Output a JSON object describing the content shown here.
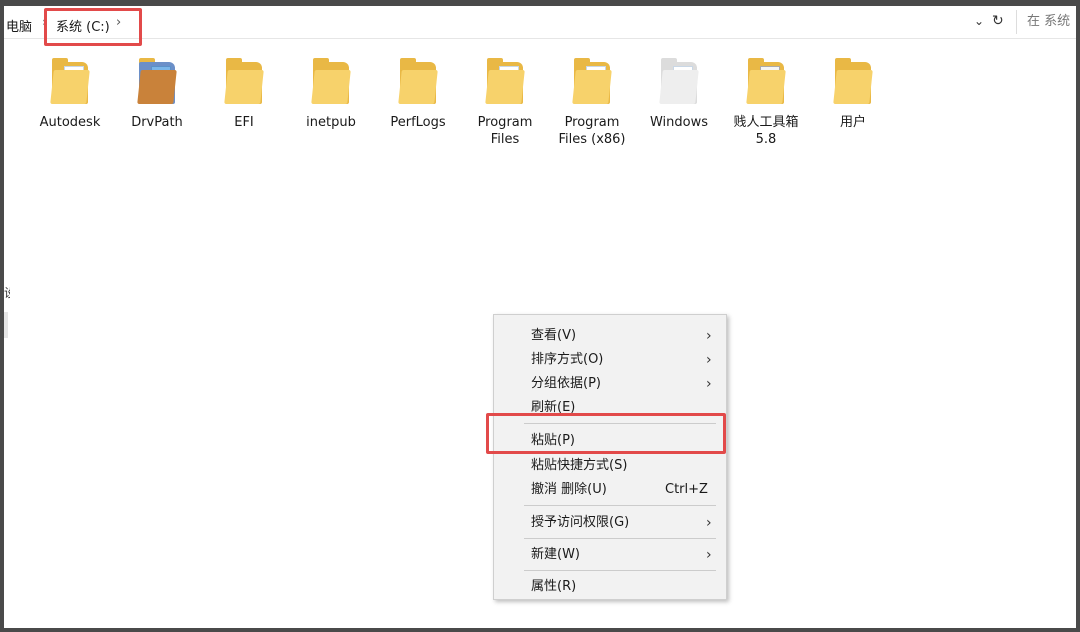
{
  "address_bar": {
    "prev_crumb": "电脑",
    "current_crumb": "系统 (C:)",
    "search_placeholder": "在 系统"
  },
  "folders": [
    {
      "name": "Autodesk",
      "icon": "folder-icon"
    },
    {
      "name": "DrvPath",
      "icon": "winrar-folder-icon"
    },
    {
      "name": "EFI",
      "icon": "folder-icon"
    },
    {
      "name": "inetpub",
      "icon": "folder-icon"
    },
    {
      "name": "PerfLogs",
      "icon": "folder-icon"
    },
    {
      "name": "Program Files",
      "icon": "folder-icon"
    },
    {
      "name": "Program Files (x86)",
      "icon": "folder-icon"
    },
    {
      "name": "Windows",
      "icon": "folder-icon"
    },
    {
      "name": "贱人工具箱5.8",
      "icon": "folder-icon"
    },
    {
      "name": "用户",
      "icon": "folder-icon"
    }
  ],
  "left_clipped_text": "设",
  "context_menu": {
    "view": "查看(V)",
    "sort": "排序方式(O)",
    "group": "分组依据(P)",
    "refresh": "刷新(E)",
    "paste": "粘贴(P)",
    "paste_shortcut": "粘贴快捷方式(S)",
    "undo_delete": "撤消 删除(U)",
    "undo_shortcut_key": "Ctrl+Z",
    "grant_access": "授予访问权限(G)",
    "new": "新建(W)",
    "properties": "属性(R)"
  },
  "colors": {
    "highlight": "#e24a4a",
    "folder_yellow": "#f7d26b",
    "menu_bg": "#f2f2f2"
  }
}
